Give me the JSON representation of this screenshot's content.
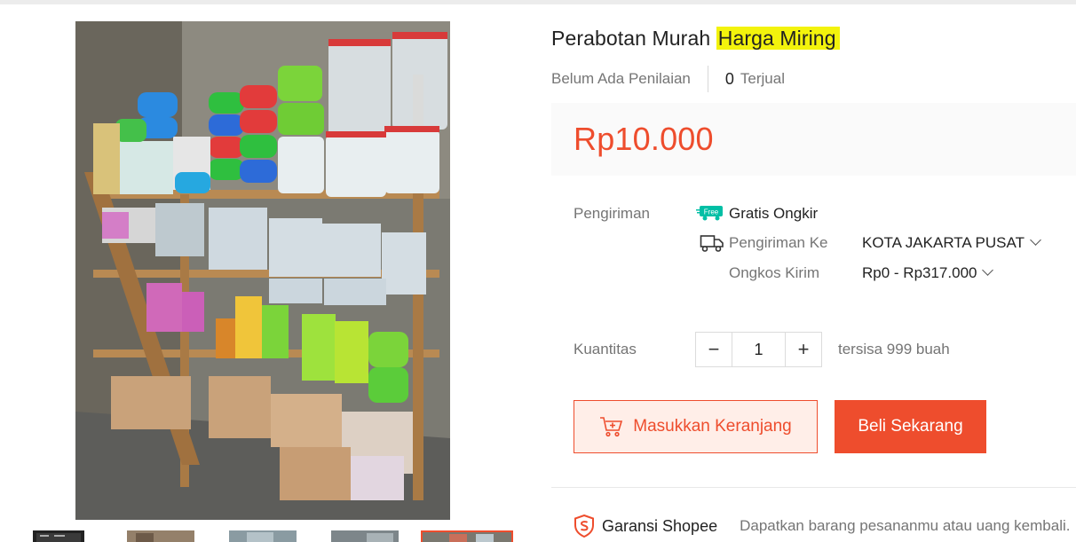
{
  "product": {
    "title_part1": "Perabotan Murah",
    "title_part2": "Harga Miring",
    "rating_text": "Belum Ada Penilaian",
    "sold_count": "0",
    "sold_label": "Terjual",
    "price": "Rp10.000"
  },
  "shipping": {
    "label": "Pengiriman",
    "free_badge": "Free",
    "free_text": "Gratis Ongkir",
    "to_label": "Pengiriman Ke",
    "to_value": "KOTA JAKARTA PUSAT",
    "cost_label": "Ongkos Kirim",
    "cost_value": "Rp0 - Rp317.000"
  },
  "quantity": {
    "label": "Kuantitas",
    "minus": "−",
    "value": "1",
    "plus": "+",
    "stock": "tersisa 999 buah"
  },
  "actions": {
    "cart_label": "Masukkan Keranjang",
    "buy_label": "Beli Sekarang"
  },
  "guarantee": {
    "label": "Garansi Shopee",
    "desc": "Dapatkan barang pesananmu atau uang kembali."
  },
  "colors": {
    "accent": "#ee4d2d",
    "highlight": "#f3f30c"
  }
}
